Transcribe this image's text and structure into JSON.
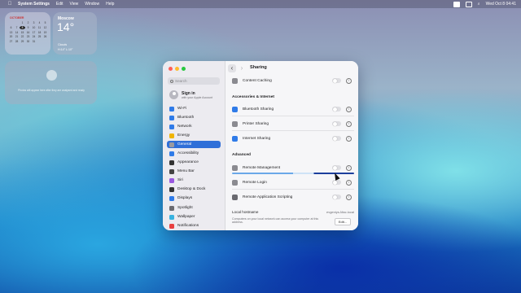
{
  "menubar": {
    "app_name": "System Settings",
    "items": [
      "Edit",
      "View",
      "Window",
      "Help"
    ],
    "datetime": "Wed Oct 8  04:41"
  },
  "widgets": {
    "calendar": {
      "month": "OCTOBER",
      "days": [
        "",
        "",
        "1",
        "2",
        "3",
        "4",
        "5",
        "6",
        "7",
        "8",
        "9",
        "10",
        "11",
        "12",
        "13",
        "14",
        "15",
        "16",
        "17",
        "18",
        "19",
        "20",
        "21",
        "22",
        "23",
        "24",
        "25",
        "26",
        "27",
        "28",
        "29",
        "30",
        "31"
      ],
      "today": "8"
    },
    "weather": {
      "city": "Moscow",
      "temp": "14°",
      "condition": "Clouds",
      "high_low": "H:14° L:10°"
    },
    "photos": {
      "text": "Photos will appear here after they are analysed and ready"
    }
  },
  "sidebar": {
    "search_placeholder": "Search",
    "signin_title": "Sign in",
    "signin_subtitle": "with your Apple Account",
    "items": [
      {
        "label": "Wi-Fi",
        "color": "#2f7be8"
      },
      {
        "label": "Bluetooth",
        "color": "#2f7be8"
      },
      {
        "label": "Network",
        "color": "#2f7be8"
      },
      {
        "label": "Energy",
        "color": "#f0b400"
      },
      {
        "label": "General",
        "color": "#9a9aa0"
      },
      {
        "label": "Accessibility",
        "color": "#2f7be8"
      },
      {
        "label": "Appearance",
        "color": "#333333"
      },
      {
        "label": "Menu Bar",
        "color": "#444444"
      },
      {
        "label": "Siri",
        "color": "#9a58e0"
      },
      {
        "label": "Desktop & Dock",
        "color": "#333333"
      },
      {
        "label": "Displays",
        "color": "#2f7be8"
      },
      {
        "label": "Spotlight",
        "color": "#6a6a70"
      },
      {
        "label": "Wallpaper",
        "color": "#38b2e0"
      },
      {
        "label": "Notifications",
        "color": "#e84040"
      }
    ],
    "selected": "General"
  },
  "content": {
    "title": "Sharing",
    "top_row": "Content Caching",
    "section_accessories": "Accessories & Internet",
    "accessories_rows": [
      "Bluetooth Sharing",
      "Printer Sharing",
      "Internet Sharing"
    ],
    "section_advanced": "Advanced",
    "advanced_rows": [
      "Remote Management",
      "Remote Login",
      "Remote Application Scripting"
    ],
    "hostname_label": "Local hostname",
    "hostname_value": "evgeniys-Mac.local",
    "hostname_desc": "Computers on your local network can access your computer at this address.",
    "edit_label": "Edit...",
    "colors": {
      "accent": "#2f6fd8"
    }
  }
}
